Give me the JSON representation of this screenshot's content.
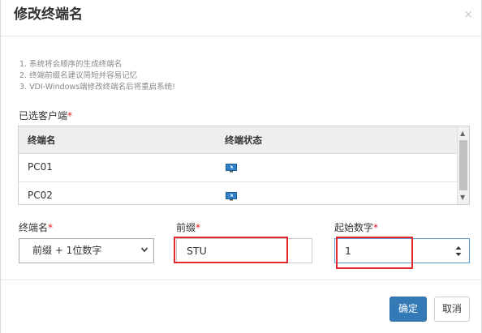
{
  "dialog": {
    "title": "修改终端名",
    "close_glyph": "×"
  },
  "notes": [
    "1. 系统将会顺序的生成终端名",
    "2. 终端前缀名建议简短并容易记忆",
    "3. VDI-Windows端修改终端名后将重启系统!"
  ],
  "selected": {
    "label": "已选客户端",
    "required_mark": "*"
  },
  "table": {
    "headers": [
      "终端名",
      "终端状态"
    ],
    "rows": [
      {
        "name": "PC01",
        "status_icon": "monitor-online-icon"
      },
      {
        "name": "PC02",
        "status_icon": "monitor-online-icon"
      }
    ]
  },
  "form": {
    "terminal_name_label": "终端名",
    "terminal_name_value": "前缀 + 1位数字",
    "prefix_label": "前缀",
    "prefix_value": "STU",
    "start_label": "起始数字",
    "start_value": "1",
    "required_mark": "*"
  },
  "buttons": {
    "ok": "确定",
    "cancel": "取消"
  },
  "colors": {
    "primary": "#337ab7",
    "required": "#e02020",
    "highlight": "#e0282e"
  }
}
